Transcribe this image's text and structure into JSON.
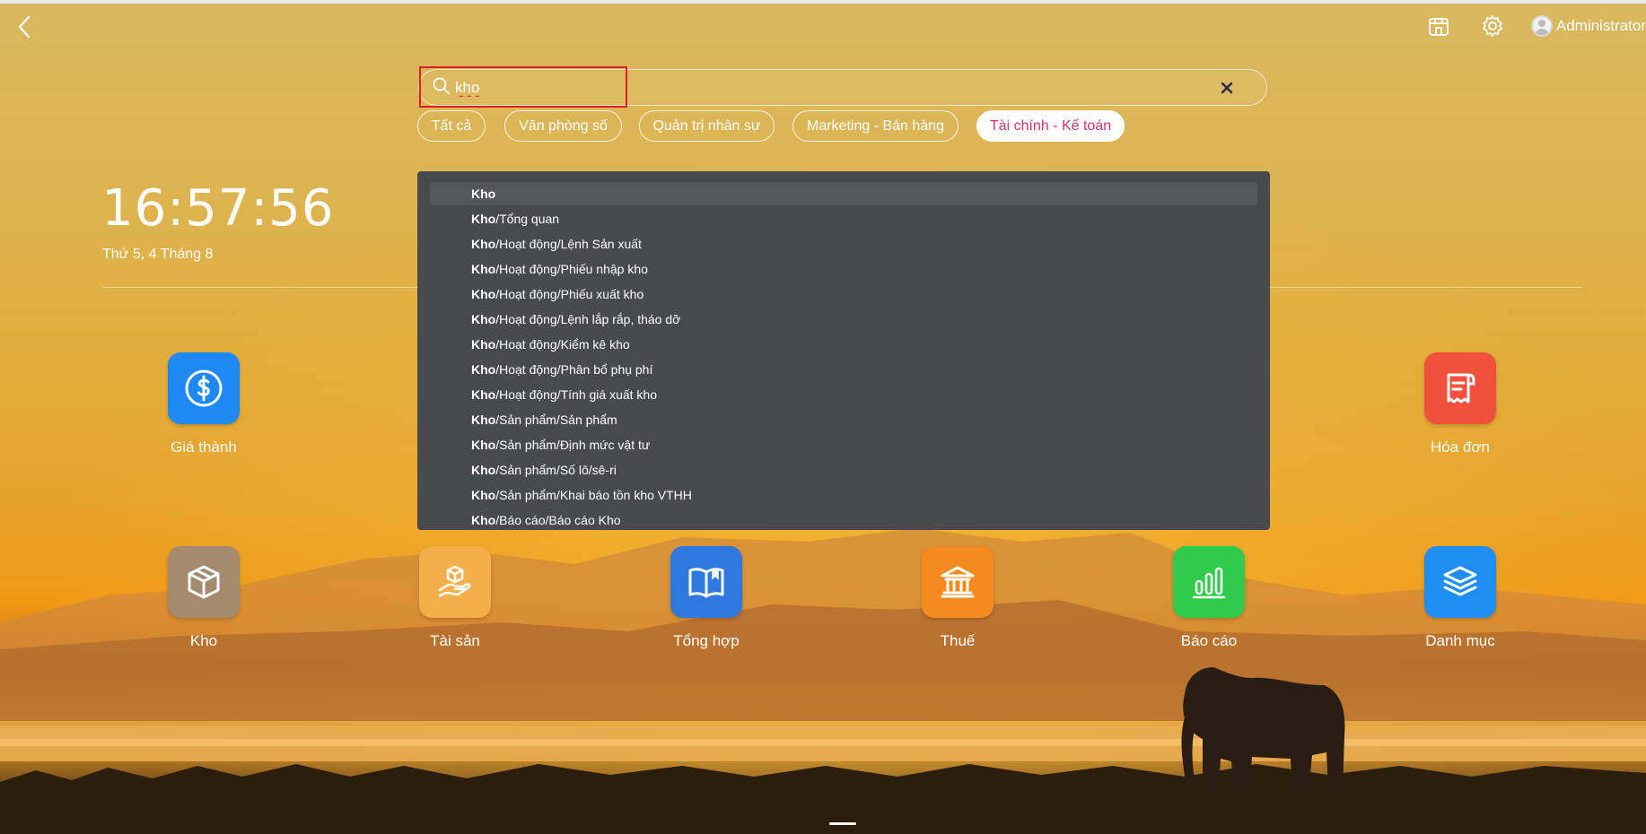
{
  "header": {
    "user_name": "Administrator"
  },
  "search": {
    "query": "kho",
    "placeholder": ""
  },
  "filters": [
    {
      "label": "Tất cả",
      "active": false
    },
    {
      "label": "Văn phòng số",
      "active": false
    },
    {
      "label": "Quản trị nhân sự",
      "active": false
    },
    {
      "label": "Marketing - Bán hàng",
      "active": false
    },
    {
      "label": "Tài chính - Kế toán",
      "active": true
    }
  ],
  "clock": {
    "time": "16:57:56",
    "date": "Thứ 5, 4 Tháng 8"
  },
  "dropdown": {
    "items": [
      {
        "bold": "Kho",
        "rest": ""
      },
      {
        "bold": "Kho",
        "rest": "/Tổng quan"
      },
      {
        "bold": "Kho",
        "rest": "/Hoạt động/Lệnh Sản xuất"
      },
      {
        "bold": "Kho",
        "rest": "/Hoạt động/Phiếu nhập kho"
      },
      {
        "bold": "Kho",
        "rest": "/Hoạt động/Phiếu xuất kho"
      },
      {
        "bold": "Kho",
        "rest": "/Hoạt động/Lệnh lắp rắp, tháo dỡ"
      },
      {
        "bold": "Kho",
        "rest": "/Hoạt động/Kiểm kê kho"
      },
      {
        "bold": "Kho",
        "rest": "/Hoạt động/Phân bổ phụ phí"
      },
      {
        "bold": "Kho",
        "rest": "/Hoạt động/Tính giá xuất kho"
      },
      {
        "bold": "Kho",
        "rest": "/Sản phẩm/Sản phẩm"
      },
      {
        "bold": "Kho",
        "rest": "/Sản phẩm/Định mức vật tư"
      },
      {
        "bold": "Kho",
        "rest": "/Sản phẩm/Số lô/sê-ri"
      },
      {
        "bold": "Kho",
        "rest": "/Sản phẩm/Khai báo tồn kho VTHH"
      },
      {
        "bold": "Kho",
        "rest": "/Báo cáo/Báo cáo Kho"
      }
    ]
  },
  "apps": {
    "gia_thanh": {
      "label": "Giá thành",
      "icon": "dollar-circle-icon",
      "color": "#1e88f5"
    },
    "hoa_don": {
      "label": "Hóa đơn",
      "icon": "receipt-icon",
      "color": "#f0503c"
    },
    "kho": {
      "label": "Kho",
      "icon": "box-icon",
      "color": "#a48a6e"
    },
    "tai_san": {
      "label": "Tài sản",
      "icon": "hand-box-icon",
      "color": "#f5ad4a"
    },
    "tong_hop": {
      "label": "Tổng hợp",
      "icon": "book-icon",
      "color": "#2f78e0"
    },
    "thue": {
      "label": "Thuế",
      "icon": "bank-icon",
      "color": "#f58a1e"
    },
    "bao_cao": {
      "label": "Báo cáo",
      "icon": "bar-chart-icon",
      "color": "#2ecc4a"
    },
    "danh_muc": {
      "label": "Danh mục",
      "icon": "layers-icon",
      "color": "#1e8ef5"
    }
  }
}
